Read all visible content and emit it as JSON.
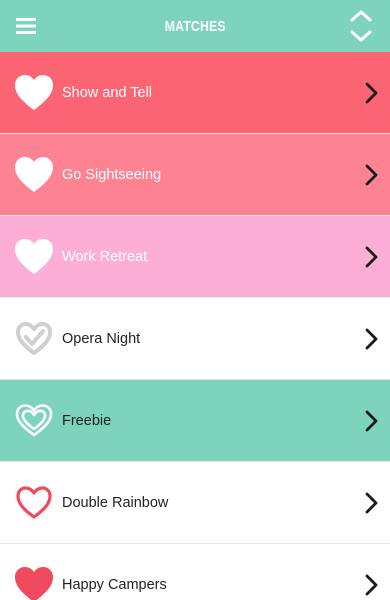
{
  "header": {
    "title": "MATCHES",
    "background": "#7ed3bd",
    "menu_icon": "hamburger-menu-icon",
    "sort_icon": "up-down-chevrons-icon"
  },
  "matches": [
    {
      "label": "Show and Tell",
      "row_color": "#fb6473",
      "text_color": "#ffffff",
      "heart": "filled",
      "heart_color": "#ffffff",
      "chevron_color": "#1a1a1a"
    },
    {
      "label": "Go Sightseeing",
      "row_color": "#fd8392",
      "text_color": "#ffffff",
      "heart": "filled",
      "heart_color": "#ffffff",
      "chevron_color": "#1a1a1a"
    },
    {
      "label": "Work Retreat",
      "row_color": "#fcaed7",
      "text_color": "#ffffff",
      "heart": "filled",
      "heart_color": "#ffffff",
      "chevron_color": "#1a1a1a"
    },
    {
      "label": "Opera Night",
      "row_color": "#ffffff",
      "text_color": "#222222",
      "heart": "check",
      "heart_color": "#cfcfcf",
      "chevron_color": "#1a1a1a"
    },
    {
      "label": "Freebie",
      "row_color": "#7ed3bd",
      "text_color": "#222222",
      "heart": "double-outline",
      "heart_color": "#ffffff",
      "chevron_color": "#1a1a1a"
    },
    {
      "label": "Double Rainbow",
      "row_color": "#ffffff",
      "text_color": "#222222",
      "heart": "outline",
      "heart_color": "#f04a5e",
      "chevron_color": "#1a1a1a"
    },
    {
      "label": "Happy Campers",
      "row_color": "#ffffff",
      "text_color": "#222222",
      "heart": "filled",
      "heart_color": "#f04a5e",
      "chevron_color": "#1a1a1a"
    }
  ]
}
